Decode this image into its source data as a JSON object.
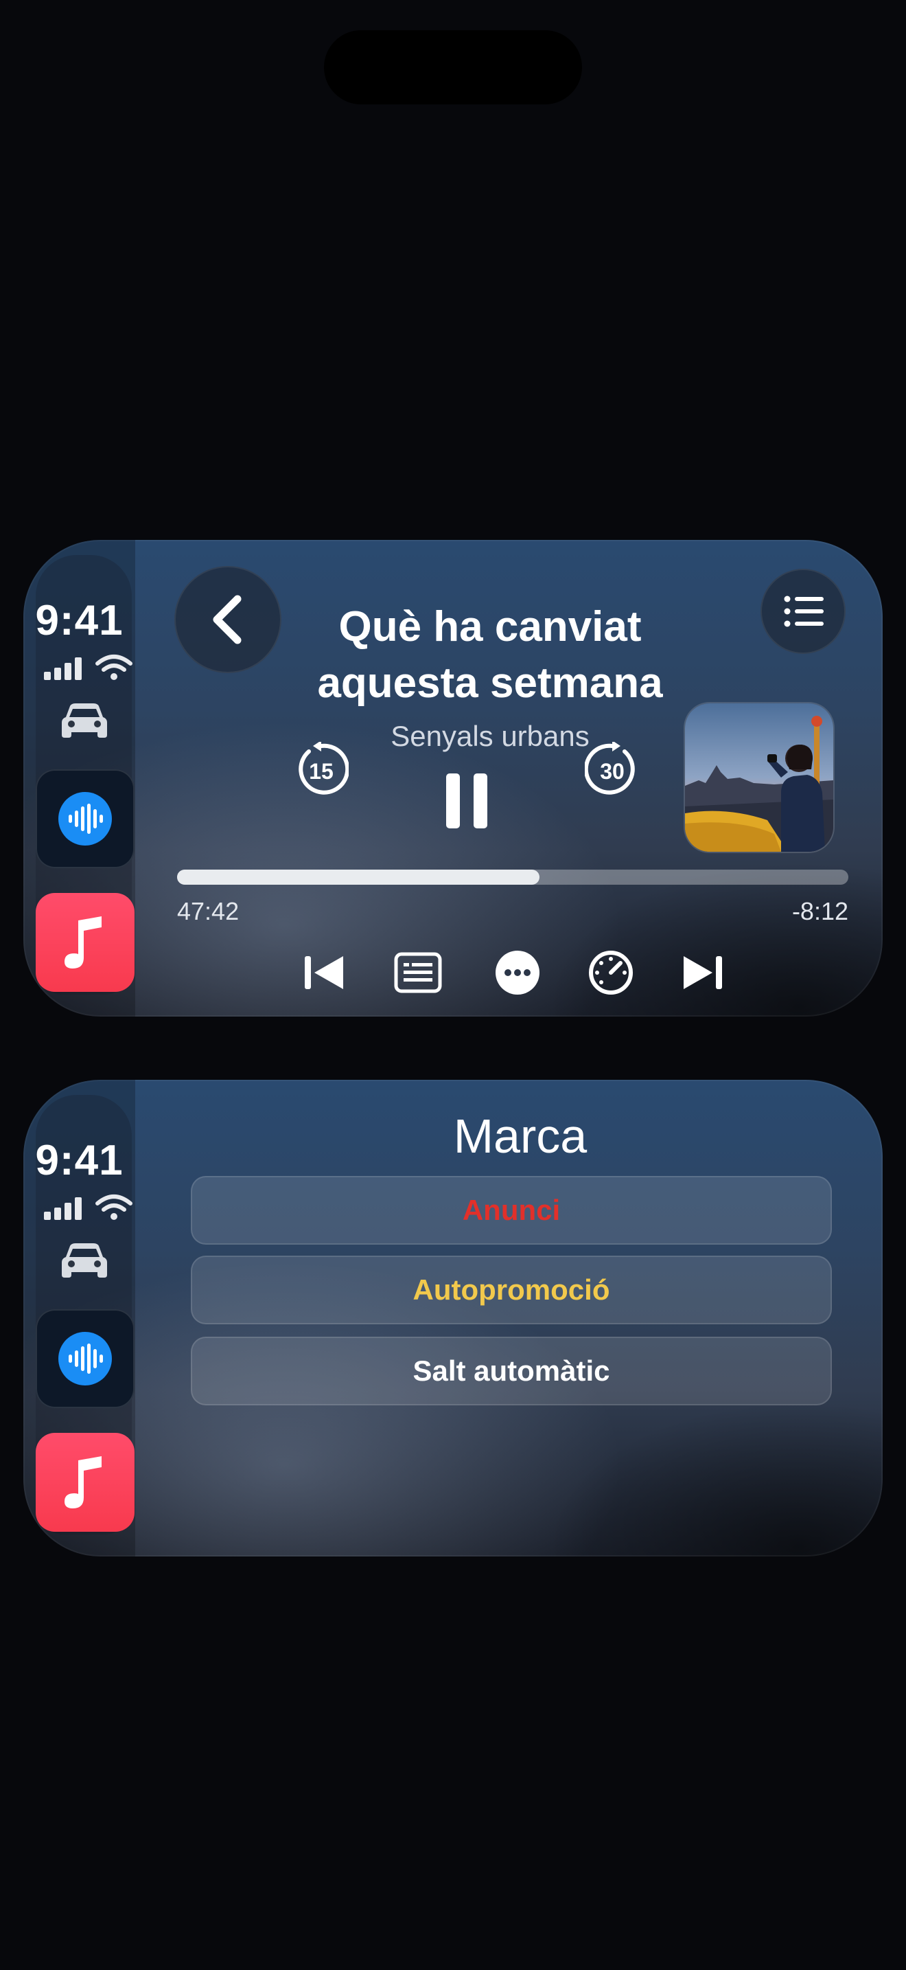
{
  "status": {
    "time": "9:41"
  },
  "now_playing": {
    "title_line1": "Què ha canviat",
    "title_line2": "aquesta setmana",
    "show": "Senyals urbans",
    "skip_back_seconds": "15",
    "skip_forward_seconds": "30",
    "elapsed": "47:42",
    "remaining": "-8:12",
    "progress_fraction": 0.54
  },
  "mark_menu": {
    "title": "Marca",
    "options": [
      {
        "label": "Anunci",
        "color": "#e2302a"
      },
      {
        "label": "Autopromoció",
        "color": "#f2c94c"
      },
      {
        "label": "Salt automàtic",
        "color": "#ffffff"
      }
    ]
  },
  "colors": {
    "podcast_accent": "#1a8df5",
    "music_accent": "#ff4c6a"
  },
  "icons": {
    "rail": [
      "signal-icon",
      "wifi-icon",
      "car-icon",
      "podcasts-app-icon",
      "music-app-icon"
    ],
    "transport": [
      "previous-track-icon",
      "transcript-icon",
      "more-icon",
      "playback-speed-icon",
      "next-track-icon"
    ]
  }
}
